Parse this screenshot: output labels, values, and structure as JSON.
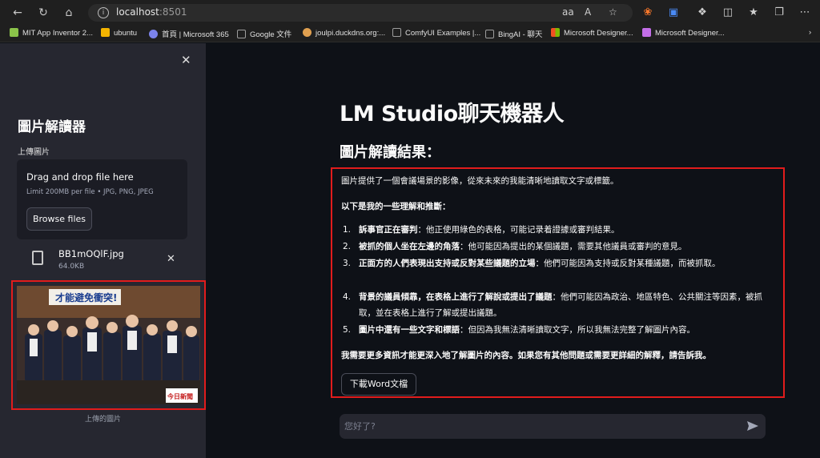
{
  "browser": {
    "url_host": "localhost",
    "url_port": ":8501",
    "bookmarks": [
      {
        "label": "MIT App Inventor 2...",
        "color": "#8bc34a"
      },
      {
        "label": "ubuntu",
        "color": "#f4b400"
      },
      {
        "label": "首頁 | Microsoft 365",
        "color": "#7b83eb"
      },
      {
        "label": "Google 文件",
        "color": "#9e9e9e"
      },
      {
        "label": "joulpi.duckdns.org:...",
        "color": "#e0a050"
      },
      {
        "label": "ComfyUI Examples |...",
        "color": "#9e9e9e"
      },
      {
        "label": "BingAI - 聊天",
        "color": "#9e9e9e"
      },
      {
        "label": "Microsoft Designer...",
        "color": "#f25022"
      },
      {
        "label": "Microsoft Designer...",
        "color": "#c36ee8"
      }
    ]
  },
  "sidebar": {
    "title": "圖片解讀器",
    "upload_label": "上傳圖片",
    "dropzone_title": "Drag and drop file here",
    "dropzone_sub": "Limit 200MB per file • JPG, PNG, JPEG",
    "browse_label": "Browse files",
    "file_name": "BB1mOQlF.jpg",
    "file_size": "64.0KB",
    "image_caption": "上傳的圖片",
    "photo_banner": "才能避免衝突!",
    "photo_sign": "今日新聞"
  },
  "main": {
    "title": "LM Studio聊天機器人",
    "subtitle": "圖片解讀結果：",
    "intro": "圖片提供了一個會議場景的影像，從來未來的我能清晰地讀取文字或標籤。",
    "list_heading": "以下是我的一些理解和推斷：",
    "items": [
      {
        "num": "1.",
        "bold": "訴事官正在審判",
        "text": "：他正使用綠色的表格，可能记录着證據或審判結果。"
      },
      {
        "num": "2.",
        "bold": "被抓的個人坐在左邊的角落",
        "text": "：他可能因為提出的某個議題，需要其他議員或審判的意見。"
      },
      {
        "num": "3.",
        "bold": "正面方的人們表現出支持或反對某些議題的立場",
        "text": "：他們可能因為支持或反對某種議題，而被抓取。"
      },
      {
        "num": "4.",
        "bold": "背景的議員傾靠，在表格上進行了解說或提出了議題",
        "text": "：他們可能因為政治、地區特色、公共關注等因素，被抓取，並在表格上進行了解或提出議題。"
      },
      {
        "num": "5.",
        "bold": "圖片中還有一些文字和標語",
        "text": "：但因為我無法清晰讀取文字，所以我無法完整了解圖片內容。"
      }
    ],
    "closing": "我需要更多資訊才能更深入地了解圖片的內容。如果您有其他問題或需要更詳細的解釋，請告訴我。",
    "download_label": "下載Word文檔",
    "chat_placeholder": "您好了?"
  },
  "colors": {
    "highlight": "#e11c1c",
    "app_bg": "#0e1117",
    "sidebar_bg": "#262730"
  }
}
